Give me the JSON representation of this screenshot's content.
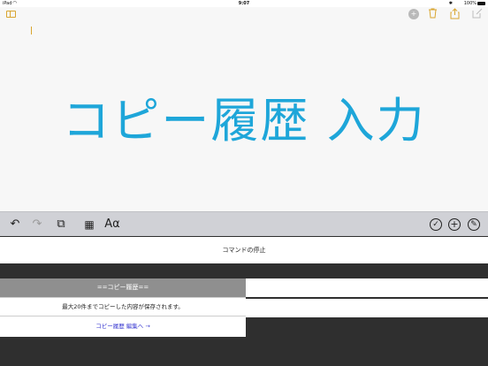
{
  "status_bar": {
    "device": "iPad",
    "wifi_icon": "wifi-icon",
    "time": "9:07",
    "bluetooth": "✱",
    "battery_text": "100%",
    "battery_level": 1.0
  },
  "note": {
    "title": "コピー履歴 入力",
    "accent_color": "#d9a52f",
    "title_color": "#1ea6d9"
  },
  "toolbar": {
    "undo_glyph": "↶",
    "redo_glyph": "↷",
    "copy_glyph": "⧉",
    "table_glyph": "▦",
    "format_label": "Aα",
    "check_glyph": "✓",
    "plus_glyph": "+",
    "pen_glyph": "✎"
  },
  "nav": {
    "trash_glyph": "🗑",
    "share_glyph": "⇪",
    "compose_glyph": "✎",
    "collab_glyph": "+"
  },
  "keyboard_panel": {
    "stop_command_label": "コマンドの停止",
    "history_header": "==コピー履歴==",
    "history_info": "最大20件までコピーした内容が保存されます。",
    "edit_link": "コピー履歴 編集へ →"
  }
}
